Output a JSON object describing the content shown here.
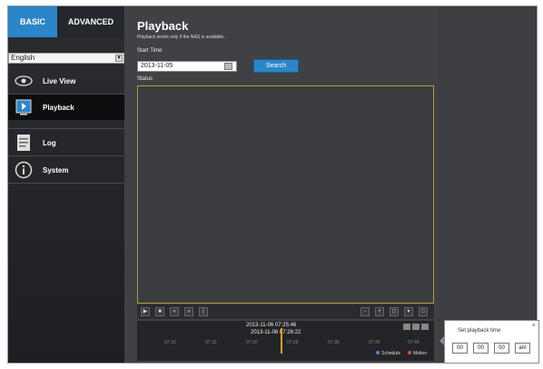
{
  "tabs": {
    "basic": "BASIC",
    "advanced": "ADVANCED"
  },
  "language": {
    "selected": "English"
  },
  "nav": [
    {
      "label": "Live View",
      "icon": "eye-icon"
    },
    {
      "label": "Playback",
      "icon": "playback-icon"
    },
    {
      "label": "Log",
      "icon": "log-icon"
    },
    {
      "label": "System",
      "icon": "info-icon"
    }
  ],
  "main": {
    "title": "Playback",
    "subtitle": "Playback works only if the NAS is available.",
    "start_time_label": "Start Time",
    "start_date": "2013-11-05",
    "search_label": "Search",
    "status_label": "Status"
  },
  "timeline": {
    "date_line1": "2013-11-06 07:25:46",
    "date_line2": "2013-11-06 07:26:22",
    "ticks": [
      "07:10",
      "07:15",
      "07:20",
      "07:25",
      "07:30",
      "07:35",
      "07:40"
    ],
    "legend": {
      "schedule": "Schedule",
      "motion": "Motion"
    },
    "colors": {
      "schedule": "#5b7fd8",
      "motion": "#d94a4a",
      "marker": "#e7a01e"
    }
  },
  "popup": {
    "title": "Set playback time",
    "hours": "00",
    "minutes": "00",
    "seconds": "00",
    "ampm": "am"
  }
}
